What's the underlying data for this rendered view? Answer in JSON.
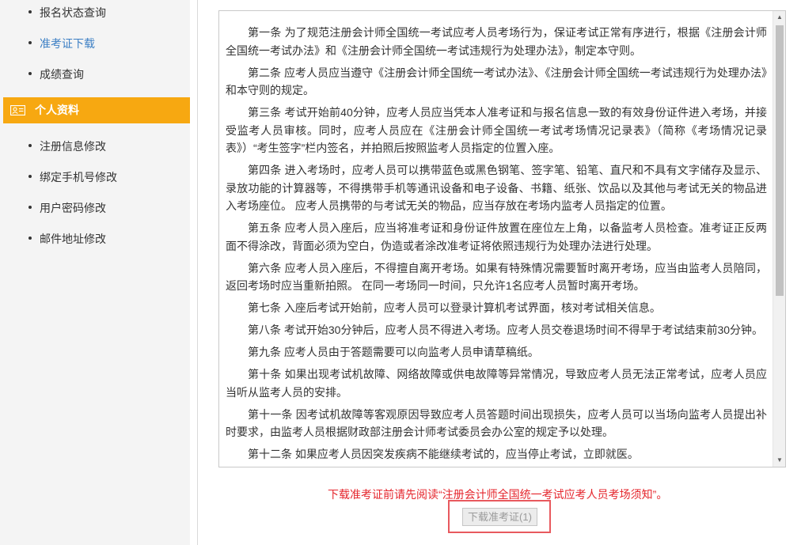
{
  "sidebar": {
    "items_top": [
      {
        "label": "报名状态查询",
        "active": false
      },
      {
        "label": "准考证下载",
        "active": true
      },
      {
        "label": "成绩查询",
        "active": false
      }
    ],
    "section_title": "个人资料",
    "section_icon": "id-card-icon",
    "items_bottom": [
      {
        "label": "注册信息修改"
      },
      {
        "label": "绑定手机号修改"
      },
      {
        "label": "用户密码修改"
      },
      {
        "label": "邮件地址修改"
      }
    ]
  },
  "rules": [
    "第一条 为了规范注册会计师全国统一考试应考人员考场行为，保证考试正常有序进行，根据《注册会计师全国统一考试办法》和《注册会计师全国统一考试违规行为处理办法》，制定本守则。",
    "第二条 应考人员应当遵守《注册会计师全国统一考试办法》、《注册会计师全国统一考试违规行为处理办法》和本守则的规定。",
    "第三条 考试开始前40分钟，应考人员应当凭本人准考证和与报名信息一致的有效身份证件进入考场，并接受监考人员审核。同时，应考人员应在《注册会计师全国统一考试考场情况记录表》（简称《考场情况记录表》）“考生签字”栏内签名，并拍照后按照监考人员指定的位置入座。",
    "第四条 进入考场时，应考人员可以携带蓝色或黑色钢笔、签字笔、铅笔、直尺和不具有文字储存及显示、录放功能的计算器等，不得携带手机等通讯设备和电子设备、书籍、纸张、饮品以及其他与考试无关的物品进入考场座位。 应考人员携带的与考试无关的物品，应当存放在考场内监考人员指定的位置。",
    "第五条 应考人员入座后，应当将准考证和身份证件放置在座位左上角，以备监考人员检查。准考证正反两面不得涂改，背面必须为空白，伪造或者涂改准考证将依照违规行为处理办法进行处理。",
    "第六条 应考人员入座后，不得擅自离开考场。如果有特殊情况需要暂时离开考场，应当由监考人员陪同，返回考场时应当重新拍照。 在同一考场同一时间，只允许1名应考人员暂时离开考场。",
    "第七条 入座后考试开始前，应考人员可以登录计算机考试界面，核对考试相关信息。",
    "第八条 考试开始30分钟后，应考人员不得进入考场。应考人员交卷退场时间不得早于考试结束前30分钟。",
    "第九条 应考人员由于答题需要可以向监考人员申请草稿纸。",
    "第十条 如果出现考试机故障、网络故障或供电故障等异常情况，导致应考人员无法正常考试，应考人员应当听从监考人员的安排。",
    "第十一条 因考试机故障等客观原因导致应考人员答题时间出现损失，应考人员可以当场向监考人员提出补时要求，由监考人员根据财政部注册会计师考试委员会办公室的规定予以处理。",
    "第十二条 如果应考人员因突发疾病不能继续考试的，应当停止考试，立即就医。"
  ],
  "notice": "下载准考证前请先阅读“注册会计师全国统一考试应考人员考场须知”。",
  "download_button": "下载准考证(1)",
  "colors": {
    "accent": "#f7a811",
    "active_link": "#3c7fc4",
    "notice": "#e5262d",
    "highlight_border": "#e8595e"
  }
}
